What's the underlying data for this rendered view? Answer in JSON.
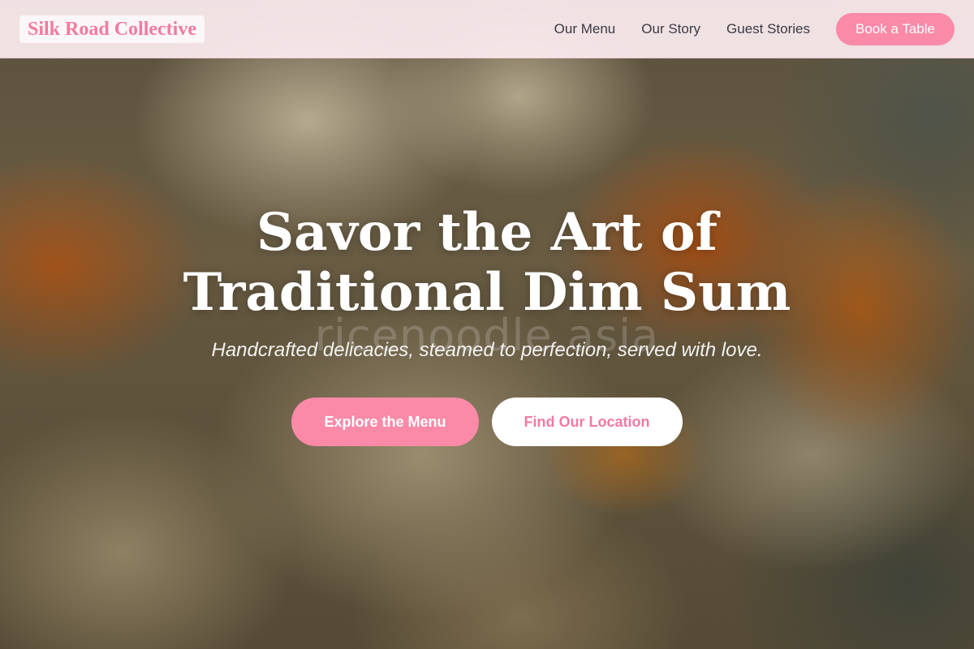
{
  "brand": {
    "name": "Silk Road Collective",
    "accent_color": "#fa8aa8"
  },
  "nav": {
    "links": [
      "Our Menu",
      "Our Story",
      "Guest Stories"
    ],
    "book_label": "Book a Table"
  },
  "hero": {
    "headline_line1": "Savor the Art of",
    "headline_line2": "Traditional Dim Sum",
    "subheadline": "Handcrafted delicacies, steamed to perfection, served with love.",
    "watermark": "ricenoodle.asia",
    "primary_cta": "Explore the Menu",
    "secondary_cta": "Find Our Location"
  }
}
